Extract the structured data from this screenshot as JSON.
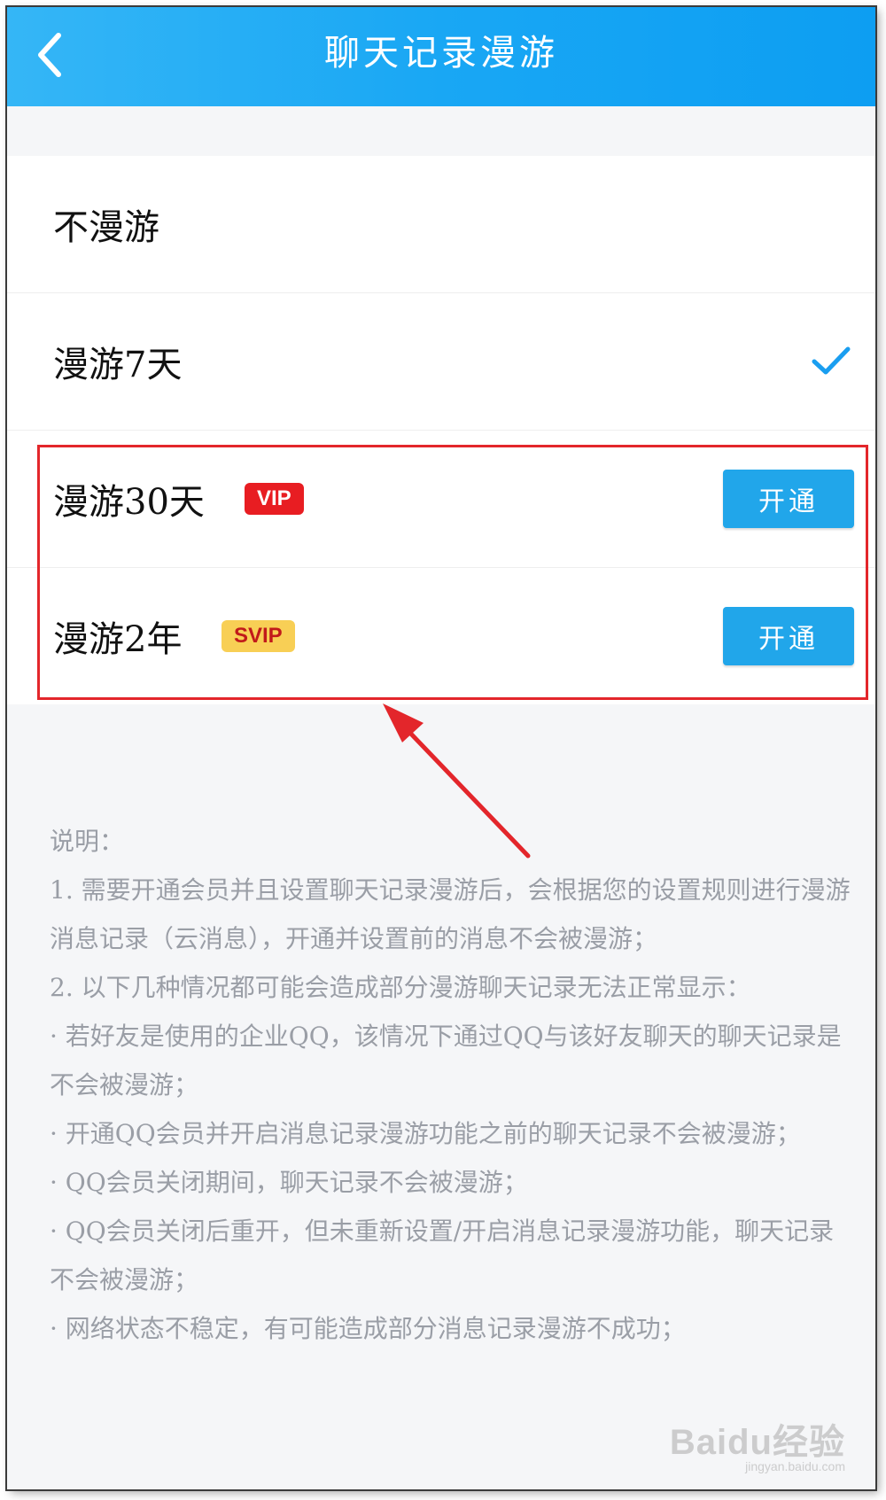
{
  "header": {
    "title": "聊天记录漫游"
  },
  "options": [
    {
      "label": "不漫游"
    },
    {
      "label": "漫游7天",
      "selected": true
    },
    {
      "label": "漫游30天",
      "badge": "VIP",
      "button": "开通"
    },
    {
      "label": "漫游2年",
      "badge": "SVIP",
      "button": "开通"
    }
  ],
  "notes": [
    "说明：",
    "1. 需要开通会员并且设置聊天记录漫游后，会根据您的设置规则进行漫游消息记录（云消息），开通并设置前的消息不会被漫游；",
    "2. 以下几种情况都可能会造成部分漫游聊天记录无法正常显示：",
    "· 若好友是使用的企业QQ，该情况下通过QQ与该好友聊天的聊天记录是不会被漫游；",
    "· 开通QQ会员并开启消息记录漫游功能之前的聊天记录不会被漫游；",
    "· QQ会员关闭期间，聊天记录不会被漫游；",
    "· QQ会员关闭后重开，但未重新设置/开启消息记录漫游功能，聊天记录不会被漫游；",
    "· 网络状态不稳定，有可能造成部分消息记录漫游不成功；"
  ],
  "watermark": {
    "main": "Baidu经验",
    "url": "jingyan.baidu.com"
  },
  "colors": {
    "header_blue": "#19a7f4",
    "button_blue": "#21a6ea",
    "vip_red": "#e81d22",
    "svip_gold": "#f8cf55",
    "annotation_red": "#e3262b"
  },
  "icons": {
    "back": "chevron-left-icon",
    "selected": "checkmark-icon"
  }
}
